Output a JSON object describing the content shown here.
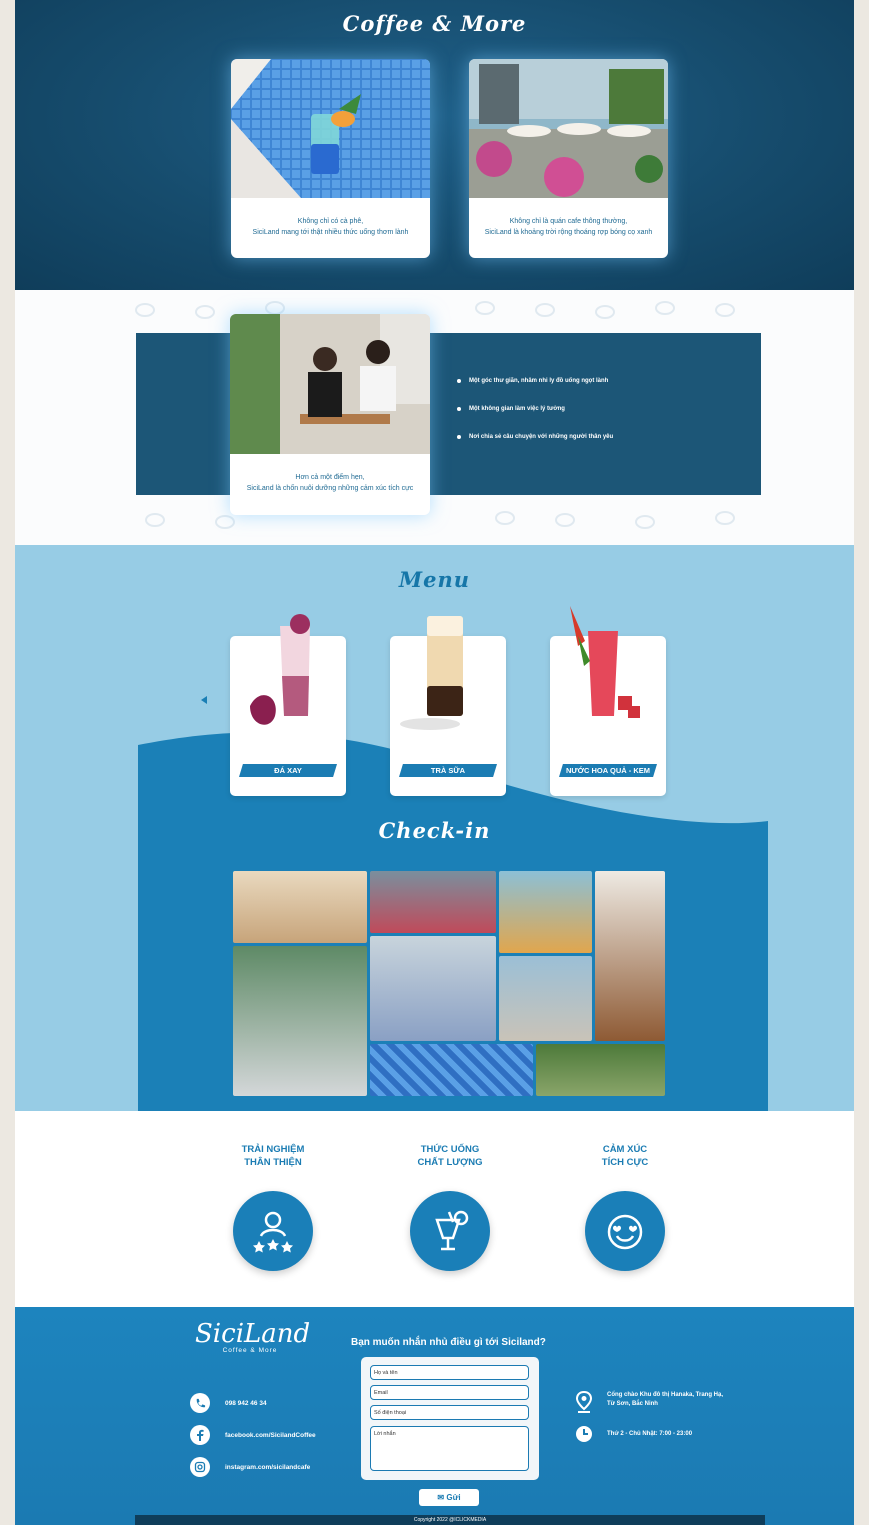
{
  "colors": {
    "dark_blue": "#164c6d",
    "light_blue": "#97cce5",
    "brand_blue": "#1b7cb3"
  },
  "coffee_more": {
    "title": "Coffee & More",
    "cards": [
      {
        "caption_line1": "Không chỉ có cà phê,",
        "caption_line2": "SiciLand mang tới thật nhiều thức uống thơm lành"
      },
      {
        "caption_line1": "Không chỉ là quán cafe thông thường,",
        "caption_line2": "SiciLand là khoảng trời rộng thoáng rợp bóng cọ xanh"
      }
    ]
  },
  "meeting": {
    "caption_line1": "Hơn cả một điểm hẹn,",
    "caption_line2": "SiciLand là chốn nuôi dưỡng những cảm xúc tích cực",
    "bullets": [
      "Một góc thư giãn, nhâm nhi ly đồ uống ngọt lành",
      "Một không gian làm việc lý tưởng",
      "Nơi chia sẻ câu chuyện với những người thân yêu"
    ]
  },
  "menu": {
    "title": "Menu",
    "items": [
      {
        "label": "ĐÁ XAY",
        "icon": "smoothie-photo"
      },
      {
        "label": "TRÀ SỮA",
        "icon": "milk-tea-photo"
      },
      {
        "label": "NƯỚC HOA QUẢ - KEM",
        "icon": "fruit-juice-photo"
      }
    ]
  },
  "checkin": {
    "title": "Check-in"
  },
  "features": [
    {
      "line1": "TRẢI NGHIỆM",
      "line2": "THÂN THIỆN",
      "icon": "user-stars-icon"
    },
    {
      "line1": "THỨC UỐNG",
      "line2": "CHẤT LƯỢNG",
      "icon": "drink-icon"
    },
    {
      "line1": "CẢM XÚC",
      "line2": "TÍCH CỰC",
      "icon": "smile-hearts-icon"
    }
  ],
  "footer": {
    "logo_text": "SiciLand",
    "logo_sub": "Coffee & More",
    "phone": "098 942 46 34",
    "facebook": "facebook.com/SicilandCoffee",
    "instagram": "instagram.com/sicilandcafe",
    "form_title": "Bạn muốn nhắn nhủ điều gì tới Siciland?",
    "form": {
      "name_placeholder": "Họ và tên",
      "email_placeholder": "Email",
      "phone_placeholder": "Số điện thoại",
      "message_placeholder": "Lời nhắn",
      "send_label": "Gửi"
    },
    "address_line1": "Cổng chào Khu đô thị Hanaka, Trang Hạ,",
    "address_line2": "Từ Sơn, Bắc Ninh",
    "hours": "Thứ 2 - Chủ Nhật: 7:00 - 23:00",
    "copyright": "Copyright 2022 @ICLICKMEDIA"
  }
}
